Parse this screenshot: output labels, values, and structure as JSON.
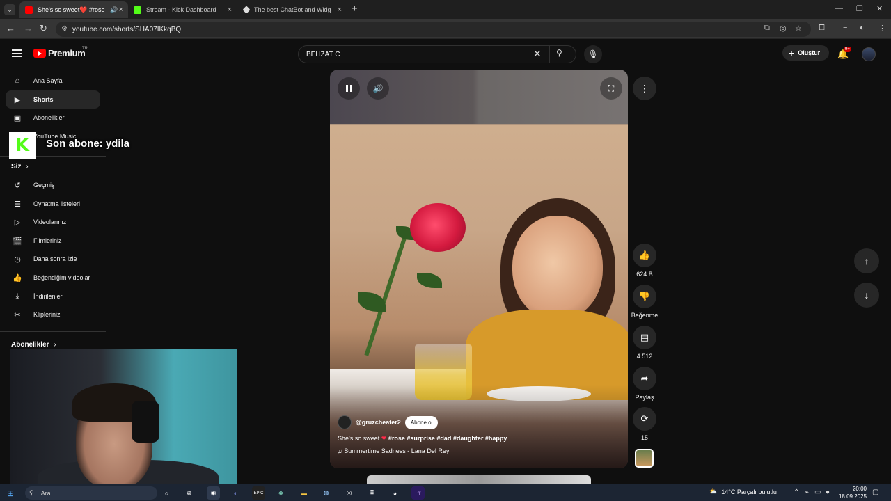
{
  "browser": {
    "tabs": [
      {
        "title": "She's so sweet❤️ #rose #su",
        "active": true
      },
      {
        "title": "Stream - Kick Dashboard",
        "active": false
      },
      {
        "title": "The best ChatBot and Widgets",
        "active": false
      }
    ],
    "url": "youtube.com/shorts/SHA07IKkqBQ"
  },
  "header": {
    "logo_text": "Premium",
    "logo_country": "TR",
    "search_value": "BEHZAT C",
    "create_label": "Oluştur",
    "notification_count": "9+"
  },
  "sidebar": {
    "items": [
      {
        "label": "Ana Sayfa",
        "icon": "home-icon"
      },
      {
        "label": "Shorts",
        "icon": "shorts-icon"
      },
      {
        "label": "Abonelikler",
        "icon": "subscriptions-icon"
      },
      {
        "label": "YouTube Music",
        "icon": "music-icon"
      }
    ],
    "you_section": "Siz",
    "you_items": [
      {
        "label": "Geçmiş"
      },
      {
        "label": "Oynatma listeleri"
      },
      {
        "label": "Videolarınız"
      },
      {
        "label": "Filmleriniz"
      },
      {
        "label": "Daha sonra izle"
      },
      {
        "label": "Beğendiğim videolar"
      },
      {
        "label": "İndirilenler"
      },
      {
        "label": "Klipleriniz"
      }
    ],
    "subscriptions_section": "Abonelikler"
  },
  "overlay": {
    "kick_text": "Son abone: ydila"
  },
  "short": {
    "channel": "@gruzcheater2",
    "subscribe_label": "Abone ol",
    "caption_prefix": "She's so sweet",
    "caption_tags": "#rose #surprise #dad #daughter #happy",
    "music": "Summertime Sadness - Lana Del Rey"
  },
  "actions": {
    "likes": "624 B",
    "dislike_label": "Beğenme",
    "comments": "4.512",
    "share_label": "Paylaş",
    "remix_count": "15"
  },
  "taskbar": {
    "search_placeholder": "Ara",
    "weather": "14°C  Parçalı bulutlu",
    "time": "20:00",
    "date": "18.09.2025"
  }
}
